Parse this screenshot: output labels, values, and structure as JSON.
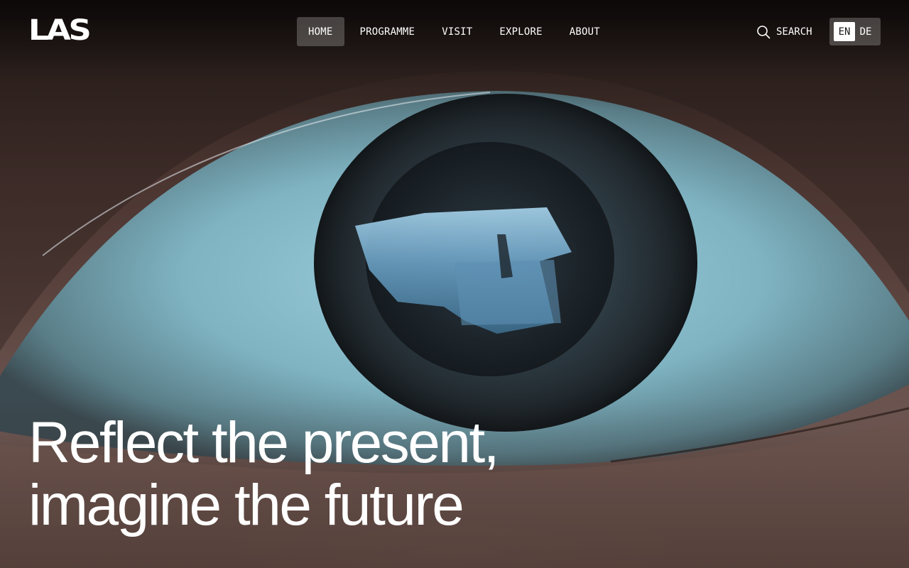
{
  "brand": {
    "logo_text": "LAS"
  },
  "nav": {
    "items": [
      {
        "label": "HOME",
        "active": true
      },
      {
        "label": "PROGRAMME",
        "active": false
      },
      {
        "label": "VISIT",
        "active": false
      },
      {
        "label": "EXPLORE",
        "active": false
      },
      {
        "label": "ABOUT",
        "active": false
      }
    ]
  },
  "search": {
    "label": "SEARCH",
    "icon": "search-icon"
  },
  "language": {
    "options": [
      "EN",
      "DE"
    ],
    "selected": "EN"
  },
  "hero": {
    "headline_line1": "Reflect the present,",
    "headline_line2": "imagine the future",
    "image": "close-up-eye-with-reflection"
  },
  "colors": {
    "text": "#ffffff",
    "active_nav_bg": "rgba(255,255,255,0.22)",
    "lang_selected_bg": "#ffffff"
  }
}
